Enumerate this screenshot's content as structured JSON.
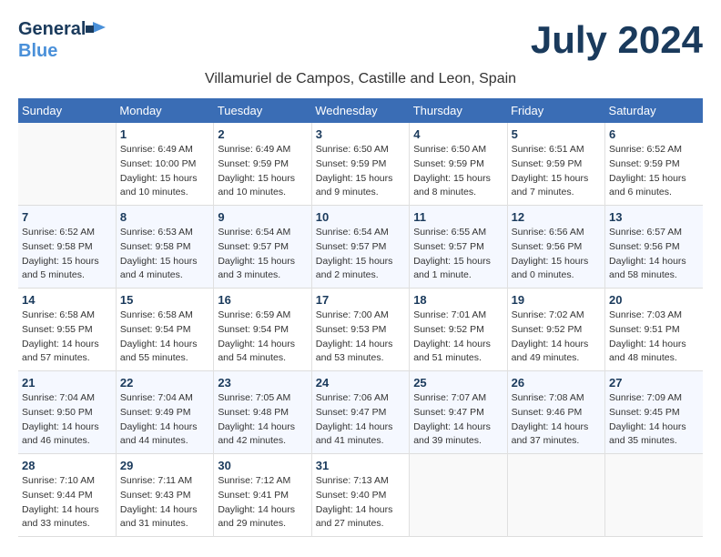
{
  "header": {
    "logo_line1": "General",
    "logo_line2": "Blue",
    "month_year": "July 2024",
    "location": "Villamuriel de Campos, Castille and Leon, Spain"
  },
  "weekdays": [
    "Sunday",
    "Monday",
    "Tuesday",
    "Wednesday",
    "Thursday",
    "Friday",
    "Saturday"
  ],
  "weeks": [
    [
      {
        "day": "",
        "sunrise": "",
        "sunset": "",
        "daylight": ""
      },
      {
        "day": "1",
        "sunrise": "Sunrise: 6:49 AM",
        "sunset": "Sunset: 10:00 PM",
        "daylight": "Daylight: 15 hours and 10 minutes."
      },
      {
        "day": "2",
        "sunrise": "Sunrise: 6:49 AM",
        "sunset": "Sunset: 9:59 PM",
        "daylight": "Daylight: 15 hours and 10 minutes."
      },
      {
        "day": "3",
        "sunrise": "Sunrise: 6:50 AM",
        "sunset": "Sunset: 9:59 PM",
        "daylight": "Daylight: 15 hours and 9 minutes."
      },
      {
        "day": "4",
        "sunrise": "Sunrise: 6:50 AM",
        "sunset": "Sunset: 9:59 PM",
        "daylight": "Daylight: 15 hours and 8 minutes."
      },
      {
        "day": "5",
        "sunrise": "Sunrise: 6:51 AM",
        "sunset": "Sunset: 9:59 PM",
        "daylight": "Daylight: 15 hours and 7 minutes."
      },
      {
        "day": "6",
        "sunrise": "Sunrise: 6:52 AM",
        "sunset": "Sunset: 9:59 PM",
        "daylight": "Daylight: 15 hours and 6 minutes."
      }
    ],
    [
      {
        "day": "7",
        "sunrise": "Sunrise: 6:52 AM",
        "sunset": "Sunset: 9:58 PM",
        "daylight": "Daylight: 15 hours and 5 minutes."
      },
      {
        "day": "8",
        "sunrise": "Sunrise: 6:53 AM",
        "sunset": "Sunset: 9:58 PM",
        "daylight": "Daylight: 15 hours and 4 minutes."
      },
      {
        "day": "9",
        "sunrise": "Sunrise: 6:54 AM",
        "sunset": "Sunset: 9:57 PM",
        "daylight": "Daylight: 15 hours and 3 minutes."
      },
      {
        "day": "10",
        "sunrise": "Sunrise: 6:54 AM",
        "sunset": "Sunset: 9:57 PM",
        "daylight": "Daylight: 15 hours and 2 minutes."
      },
      {
        "day": "11",
        "sunrise": "Sunrise: 6:55 AM",
        "sunset": "Sunset: 9:57 PM",
        "daylight": "Daylight: 15 hours and 1 minute."
      },
      {
        "day": "12",
        "sunrise": "Sunrise: 6:56 AM",
        "sunset": "Sunset: 9:56 PM",
        "daylight": "Daylight: 15 hours and 0 minutes."
      },
      {
        "day": "13",
        "sunrise": "Sunrise: 6:57 AM",
        "sunset": "Sunset: 9:56 PM",
        "daylight": "Daylight: 14 hours and 58 minutes."
      }
    ],
    [
      {
        "day": "14",
        "sunrise": "Sunrise: 6:58 AM",
        "sunset": "Sunset: 9:55 PM",
        "daylight": "Daylight: 14 hours and 57 minutes."
      },
      {
        "day": "15",
        "sunrise": "Sunrise: 6:58 AM",
        "sunset": "Sunset: 9:54 PM",
        "daylight": "Daylight: 14 hours and 55 minutes."
      },
      {
        "day": "16",
        "sunrise": "Sunrise: 6:59 AM",
        "sunset": "Sunset: 9:54 PM",
        "daylight": "Daylight: 14 hours and 54 minutes."
      },
      {
        "day": "17",
        "sunrise": "Sunrise: 7:00 AM",
        "sunset": "Sunset: 9:53 PM",
        "daylight": "Daylight: 14 hours and 53 minutes."
      },
      {
        "day": "18",
        "sunrise": "Sunrise: 7:01 AM",
        "sunset": "Sunset: 9:52 PM",
        "daylight": "Daylight: 14 hours and 51 minutes."
      },
      {
        "day": "19",
        "sunrise": "Sunrise: 7:02 AM",
        "sunset": "Sunset: 9:52 PM",
        "daylight": "Daylight: 14 hours and 49 minutes."
      },
      {
        "day": "20",
        "sunrise": "Sunrise: 7:03 AM",
        "sunset": "Sunset: 9:51 PM",
        "daylight": "Daylight: 14 hours and 48 minutes."
      }
    ],
    [
      {
        "day": "21",
        "sunrise": "Sunrise: 7:04 AM",
        "sunset": "Sunset: 9:50 PM",
        "daylight": "Daylight: 14 hours and 46 minutes."
      },
      {
        "day": "22",
        "sunrise": "Sunrise: 7:04 AM",
        "sunset": "Sunset: 9:49 PM",
        "daylight": "Daylight: 14 hours and 44 minutes."
      },
      {
        "day": "23",
        "sunrise": "Sunrise: 7:05 AM",
        "sunset": "Sunset: 9:48 PM",
        "daylight": "Daylight: 14 hours and 42 minutes."
      },
      {
        "day": "24",
        "sunrise": "Sunrise: 7:06 AM",
        "sunset": "Sunset: 9:47 PM",
        "daylight": "Daylight: 14 hours and 41 minutes."
      },
      {
        "day": "25",
        "sunrise": "Sunrise: 7:07 AM",
        "sunset": "Sunset: 9:47 PM",
        "daylight": "Daylight: 14 hours and 39 minutes."
      },
      {
        "day": "26",
        "sunrise": "Sunrise: 7:08 AM",
        "sunset": "Sunset: 9:46 PM",
        "daylight": "Daylight: 14 hours and 37 minutes."
      },
      {
        "day": "27",
        "sunrise": "Sunrise: 7:09 AM",
        "sunset": "Sunset: 9:45 PM",
        "daylight": "Daylight: 14 hours and 35 minutes."
      }
    ],
    [
      {
        "day": "28",
        "sunrise": "Sunrise: 7:10 AM",
        "sunset": "Sunset: 9:44 PM",
        "daylight": "Daylight: 14 hours and 33 minutes."
      },
      {
        "day": "29",
        "sunrise": "Sunrise: 7:11 AM",
        "sunset": "Sunset: 9:43 PM",
        "daylight": "Daylight: 14 hours and 31 minutes."
      },
      {
        "day": "30",
        "sunrise": "Sunrise: 7:12 AM",
        "sunset": "Sunset: 9:41 PM",
        "daylight": "Daylight: 14 hours and 29 minutes."
      },
      {
        "day": "31",
        "sunrise": "Sunrise: 7:13 AM",
        "sunset": "Sunset: 9:40 PM",
        "daylight": "Daylight: 14 hours and 27 minutes."
      },
      {
        "day": "",
        "sunrise": "",
        "sunset": "",
        "daylight": ""
      },
      {
        "day": "",
        "sunrise": "",
        "sunset": "",
        "daylight": ""
      },
      {
        "day": "",
        "sunrise": "",
        "sunset": "",
        "daylight": ""
      }
    ]
  ]
}
